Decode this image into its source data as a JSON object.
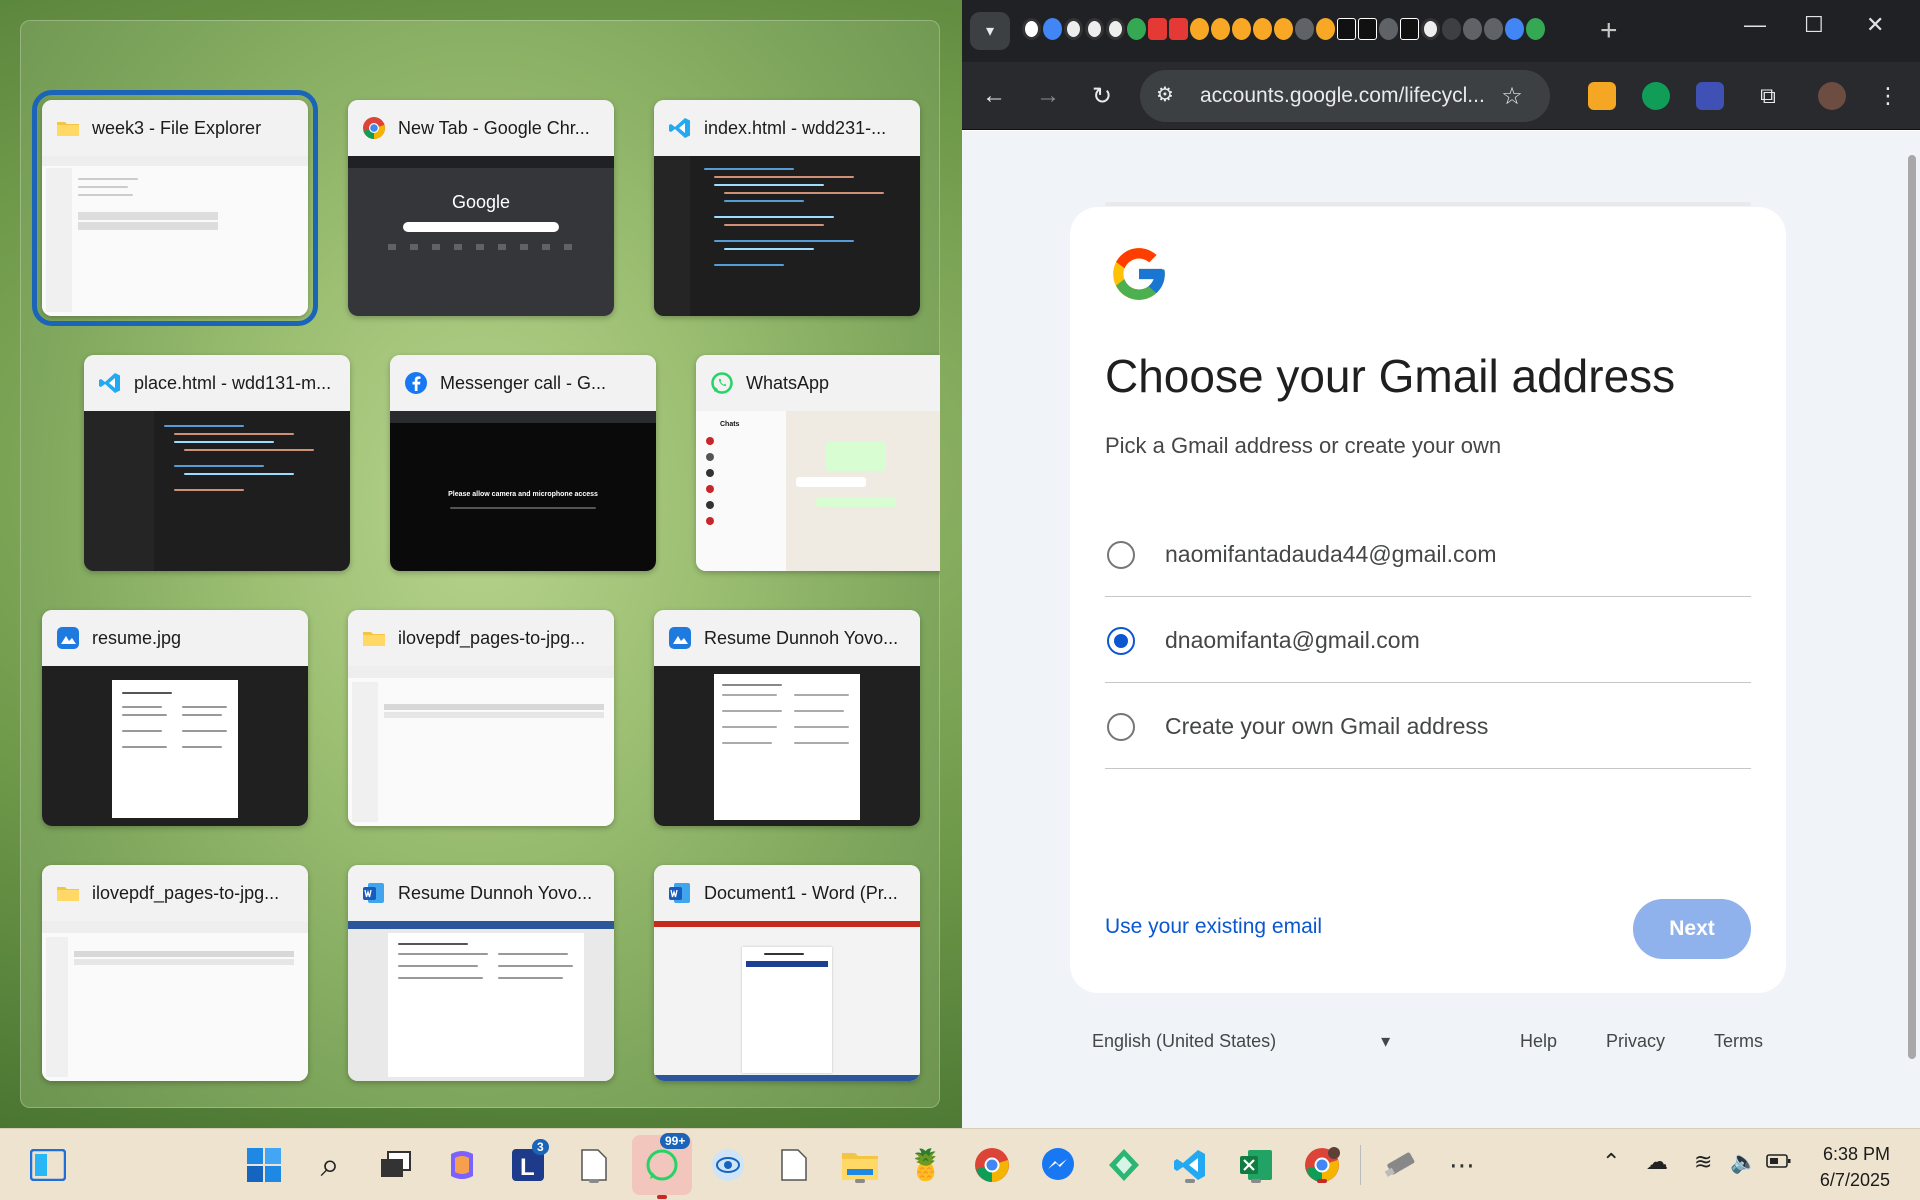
{
  "snap_assist": {
    "windows": [
      {
        "title": "week3 - File Explorer",
        "icon": "folder-icon",
        "selected": true
      },
      {
        "title": "New Tab - Google Chr...",
        "icon": "chrome-icon",
        "thumb_text": "Google"
      },
      {
        "title": "index.html - wdd231-...",
        "icon": "vscode-icon"
      },
      {
        "title": "place.html - wdd131-m...",
        "icon": "vscode-icon"
      },
      {
        "title": "Messenger call - G...",
        "icon": "facebook-icon",
        "thumb_text": "Please allow camera and microphone access"
      },
      {
        "title": "WhatsApp",
        "icon": "whatsapp-icon",
        "thumb_text": "Chats"
      },
      {
        "title": "resume.jpg",
        "icon": "photos-icon"
      },
      {
        "title": "ilovepdf_pages-to-jpg...",
        "icon": "folder-icon"
      },
      {
        "title": "Resume Dunnoh Yovo...",
        "icon": "photos-icon"
      },
      {
        "title": "ilovepdf_pages-to-jpg...",
        "icon": "folder-icon"
      },
      {
        "title": "Resume Dunnoh Yovo...",
        "icon": "word-icon"
      },
      {
        "title": "Document1 - Word (Pr...",
        "icon": "word-icon"
      }
    ]
  },
  "browser": {
    "url": "accounts.google.com/lifecycl...",
    "tabs_icons": [
      "tab-favicons"
    ],
    "colors": {
      "tabstrip": "#202124",
      "toolbar": "#282a2d",
      "accent": "#0b57d0"
    }
  },
  "signup": {
    "title": "Choose your Gmail address",
    "subtitle": "Pick a Gmail address or create your own",
    "options": [
      {
        "label": "naomifantadauda44@gmail.com",
        "selected": false
      },
      {
        "label": "dnaomifanta@gmail.com",
        "selected": true
      },
      {
        "label": "Create your own Gmail address",
        "selected": false
      }
    ],
    "existing_link": "Use your existing email",
    "next_label": "Next",
    "footer": {
      "language": "English (United States)",
      "help": "Help",
      "privacy": "Privacy",
      "terms": "Terms"
    }
  },
  "taskbar": {
    "badges": {
      "lync": "3",
      "whatsapp": "99+"
    },
    "clock": {
      "time": "6:38 PM",
      "date": "6/7/2025"
    }
  }
}
